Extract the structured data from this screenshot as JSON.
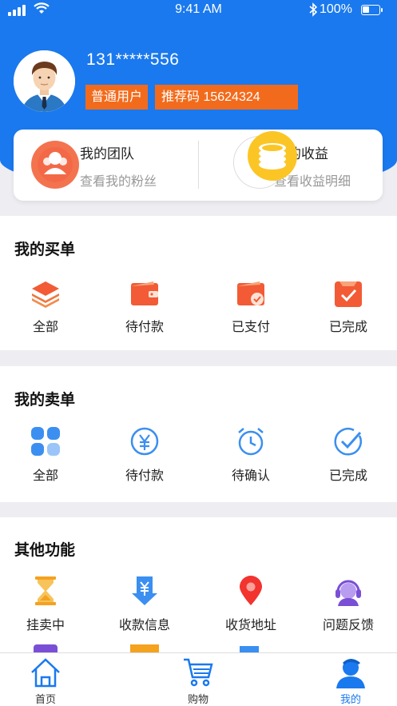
{
  "status_bar": {
    "time": "9:41 AM",
    "battery": "100%"
  },
  "profile": {
    "phone": "131*****556",
    "user_type": "普通用户",
    "referral": "推荐码 15624324"
  },
  "summary": {
    "team": {
      "title": "我的团队",
      "subtitle": "查看我的粉丝"
    },
    "earnings": {
      "title": "我的收益",
      "subtitle": "查看收益明细"
    }
  },
  "buy_orders": {
    "title": "我的买单",
    "items": [
      {
        "label": "全部",
        "icon": "layers-icon"
      },
      {
        "label": "待付款",
        "icon": "wallet-icon"
      },
      {
        "label": "已支付",
        "icon": "paid-wallet-icon"
      },
      {
        "label": "已完成",
        "icon": "check-box-icon"
      }
    ]
  },
  "sell_orders": {
    "title": "我的卖单",
    "items": [
      {
        "label": "全部",
        "icon": "grid-icon"
      },
      {
        "label": "待付款",
        "icon": "yuan-circle-icon"
      },
      {
        "label": "待确认",
        "icon": "alarm-clock-icon"
      },
      {
        "label": "已完成",
        "icon": "check-circle-icon"
      }
    ]
  },
  "other": {
    "title": "其他功能",
    "items": [
      {
        "label": "挂卖中",
        "icon": "hourglass-icon"
      },
      {
        "label": "收款信息",
        "icon": "yuan-download-icon"
      },
      {
        "label": "收货地址",
        "icon": "location-pin-icon"
      },
      {
        "label": "问题反馈",
        "icon": "headset-icon"
      }
    ]
  },
  "tabbar": {
    "home": "首页",
    "shop": "购物",
    "mine": "我的"
  },
  "colors": {
    "brand_blue": "#1a79ee",
    "accent_orange": "#f26b1c"
  }
}
